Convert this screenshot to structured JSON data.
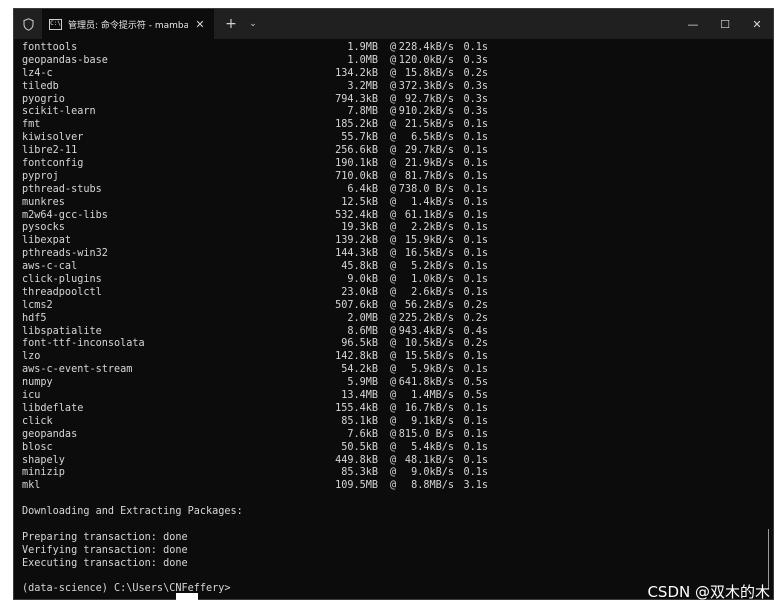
{
  "window": {
    "tab_icon_text": "C:\\",
    "tab_title": "管理员: 命令提示符 - mamba",
    "tab_close": "✕",
    "new_tab": "+",
    "dropdown": "⌄",
    "minimize": "—",
    "maximize": "☐",
    "close": "✕"
  },
  "packages": [
    {
      "name": "fonttools",
      "size": "1.9MB",
      "speed": "228.4kB/s",
      "time": "0.1s"
    },
    {
      "name": "geopandas-base",
      "size": "1.0MB",
      "speed": "120.0kB/s",
      "time": "0.3s"
    },
    {
      "name": "lz4-c",
      "size": "134.2kB",
      "speed": "15.8kB/s",
      "time": "0.2s"
    },
    {
      "name": "tiledb",
      "size": "3.2MB",
      "speed": "372.3kB/s",
      "time": "0.3s"
    },
    {
      "name": "pyogrio",
      "size": "794.3kB",
      "speed": "92.7kB/s",
      "time": "0.3s"
    },
    {
      "name": "scikit-learn",
      "size": "7.8MB",
      "speed": "910.2kB/s",
      "time": "0.3s"
    },
    {
      "name": "fmt",
      "size": "185.2kB",
      "speed": "21.5kB/s",
      "time": "0.1s"
    },
    {
      "name": "kiwisolver",
      "size": "55.7kB",
      "speed": "6.5kB/s",
      "time": "0.1s"
    },
    {
      "name": "libre2-11",
      "size": "256.6kB",
      "speed": "29.7kB/s",
      "time": "0.1s"
    },
    {
      "name": "fontconfig",
      "size": "190.1kB",
      "speed": "21.9kB/s",
      "time": "0.1s"
    },
    {
      "name": "pyproj",
      "size": "710.0kB",
      "speed": "81.7kB/s",
      "time": "0.1s"
    },
    {
      "name": "pthread-stubs",
      "size": "6.4kB",
      "speed": "738.0 B/s",
      "time": "0.1s"
    },
    {
      "name": "munkres",
      "size": "12.5kB",
      "speed": "1.4kB/s",
      "time": "0.1s"
    },
    {
      "name": "m2w64-gcc-libs",
      "size": "532.4kB",
      "speed": "61.1kB/s",
      "time": "0.1s"
    },
    {
      "name": "pysocks",
      "size": "19.3kB",
      "speed": "2.2kB/s",
      "time": "0.1s"
    },
    {
      "name": "libexpat",
      "size": "139.2kB",
      "speed": "15.9kB/s",
      "time": "0.1s"
    },
    {
      "name": "pthreads-win32",
      "size": "144.3kB",
      "speed": "16.5kB/s",
      "time": "0.1s"
    },
    {
      "name": "aws-c-cal",
      "size": "45.8kB",
      "speed": "5.2kB/s",
      "time": "0.1s"
    },
    {
      "name": "click-plugins",
      "size": "9.0kB",
      "speed": "1.0kB/s",
      "time": "0.1s"
    },
    {
      "name": "threadpoolctl",
      "size": "23.0kB",
      "speed": "2.6kB/s",
      "time": "0.1s"
    },
    {
      "name": "lcms2",
      "size": "507.6kB",
      "speed": "56.2kB/s",
      "time": "0.2s"
    },
    {
      "name": "hdf5",
      "size": "2.0MB",
      "speed": "225.2kB/s",
      "time": "0.2s"
    },
    {
      "name": "libspatialite",
      "size": "8.6MB",
      "speed": "943.4kB/s",
      "time": "0.4s"
    },
    {
      "name": "font-ttf-inconsolata",
      "size": "96.5kB",
      "speed": "10.5kB/s",
      "time": "0.2s"
    },
    {
      "name": "lzo",
      "size": "142.8kB",
      "speed": "15.5kB/s",
      "time": "0.1s"
    },
    {
      "name": "aws-c-event-stream",
      "size": "54.2kB",
      "speed": "5.9kB/s",
      "time": "0.1s"
    },
    {
      "name": "numpy",
      "size": "5.9MB",
      "speed": "641.8kB/s",
      "time": "0.5s"
    },
    {
      "name": "icu",
      "size": "13.4MB",
      "speed": "1.4MB/s",
      "time": "0.5s"
    },
    {
      "name": "libdeflate",
      "size": "155.4kB",
      "speed": "16.7kB/s",
      "time": "0.1s"
    },
    {
      "name": "click",
      "size": "85.1kB",
      "speed": "9.1kB/s",
      "time": "0.1s"
    },
    {
      "name": "geopandas",
      "size": "7.6kB",
      "speed": "815.0 B/s",
      "time": "0.1s"
    },
    {
      "name": "blosc",
      "size": "50.5kB",
      "speed": "5.4kB/s",
      "time": "0.1s"
    },
    {
      "name": "shapely",
      "size": "449.8kB",
      "speed": "48.1kB/s",
      "time": "0.1s"
    },
    {
      "name": "minizip",
      "size": "85.3kB",
      "speed": "9.0kB/s",
      "time": "0.1s"
    },
    {
      "name": "mkl",
      "size": "109.5MB",
      "speed": "8.8MB/s",
      "time": "3.1s"
    }
  ],
  "at_symbol": "@",
  "status": {
    "downloading": "Downloading and Extracting Packages:",
    "preparing": "Preparing transaction: done",
    "verifying": "Verifying transaction: done",
    "executing": "Executing transaction: done"
  },
  "prompt": "(data-science) C:\\Users\\CNFeffery>",
  "watermark": "CSDN @双木的木"
}
